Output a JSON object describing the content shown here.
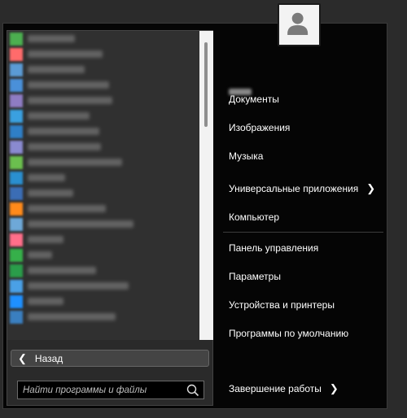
{
  "programs": [
    {
      "icon_color": "#4caf50"
    },
    {
      "icon_color": "#ff6b6b"
    },
    {
      "icon_color": "#5b9bd5"
    },
    {
      "icon_color": "#4a90d9"
    },
    {
      "icon_color": "#8e7cc3"
    },
    {
      "icon_color": "#3aa0e0"
    },
    {
      "icon_color": "#2f7fc7"
    },
    {
      "icon_color": "#8a8ad0"
    },
    {
      "icon_color": "#6bbf4e"
    },
    {
      "icon_color": "#2a8fd0"
    },
    {
      "icon_color": "#3b6db5"
    },
    {
      "icon_color": "#ff8a1a"
    },
    {
      "icon_color": "#6ea8d8"
    },
    {
      "icon_color": "#ff6f8a"
    },
    {
      "icon_color": "#36b04a"
    },
    {
      "icon_color": "#2a9d4a"
    },
    {
      "icon_color": "#4aa0e6"
    },
    {
      "icon_color": "#1e90ff"
    },
    {
      "icon_color": "#3a7fc0"
    }
  ],
  "left_pane": {
    "back_label": "Назад",
    "search_placeholder": "Найти программы и файлы"
  },
  "right_pane": {
    "items": [
      {
        "label": "Документы"
      },
      {
        "label": "Изображения"
      },
      {
        "label": "Музыка"
      },
      {
        "label": "Универсальные приложения"
      },
      {
        "label": "Компьютер"
      },
      {
        "label": "Панель управления"
      },
      {
        "label": "Параметры"
      },
      {
        "label": "Устройства и принтеры"
      },
      {
        "label": "Программы по умолчанию"
      }
    ],
    "shutdown_label": "Завершение работы"
  }
}
